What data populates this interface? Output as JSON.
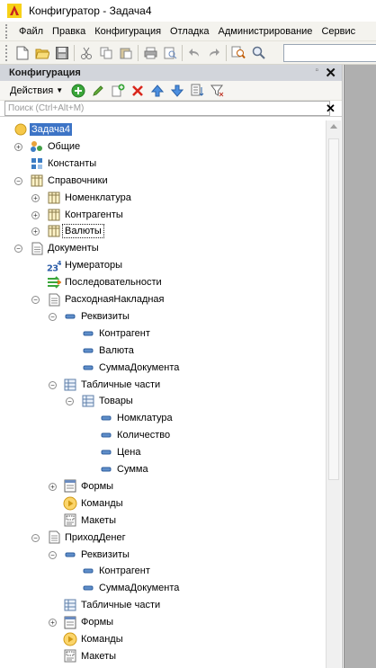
{
  "window": {
    "title": "Конфигуратор - Задача4"
  },
  "menu": [
    "Файл",
    "Правка",
    "Конфигурация",
    "Отладка",
    "Администрирование",
    "Сервис"
  ],
  "toolbar": {
    "buttons": [
      "new-document-icon",
      "open-folder-icon",
      "save-icon",
      "cut-icon",
      "copy-icon",
      "paste-icon",
      "print-icon",
      "print-preview-icon",
      "undo-icon",
      "redo-icon",
      "find-in-config-icon",
      "search-icon"
    ]
  },
  "panel": {
    "title": "Конфигурация",
    "actions_label": "Действия",
    "search_placeholder": "Поиск (Ctrl+Alt+M)"
  },
  "tree": [
    {
      "label": "Задача4",
      "icon": "config-root-icon",
      "level": 0,
      "expander": "minus",
      "selected": true
    },
    {
      "label": "Общие",
      "icon": "common-icon",
      "level": 1,
      "expander": "plus"
    },
    {
      "label": "Константы",
      "icon": "constants-icon",
      "level": 1,
      "expander": "none"
    },
    {
      "label": "Справочники",
      "icon": "catalogs-icon",
      "level": 1,
      "expander": "minus"
    },
    {
      "label": "Номенклатура",
      "icon": "catalog-icon",
      "level": 2,
      "expander": "plus"
    },
    {
      "label": "Контрагенты",
      "icon": "catalog-icon",
      "level": 2,
      "expander": "plus"
    },
    {
      "label": "Валюты",
      "icon": "catalog-icon",
      "level": 2,
      "expander": "plus",
      "focused": true
    },
    {
      "label": "Документы",
      "icon": "documents-icon",
      "level": 1,
      "expander": "minus"
    },
    {
      "label": "Нумераторы",
      "icon": "numerators-icon",
      "level": 2,
      "expander": "none"
    },
    {
      "label": "Последовательности",
      "icon": "sequences-icon",
      "level": 2,
      "expander": "none"
    },
    {
      "label": "РасходнаяНакладная",
      "icon": "document-icon",
      "level": 2,
      "expander": "minus"
    },
    {
      "label": "Реквизиты",
      "icon": "attributes-icon",
      "level": 3,
      "expander": "minus"
    },
    {
      "label": "Контрагент",
      "icon": "attribute-icon",
      "level": 4,
      "expander": "none"
    },
    {
      "label": "Валюта",
      "icon": "attribute-icon",
      "level": 4,
      "expander": "none"
    },
    {
      "label": "СуммаДокумента",
      "icon": "attribute-icon",
      "level": 4,
      "expander": "none"
    },
    {
      "label": "Табличные части",
      "icon": "tabular-sections-icon",
      "level": 3,
      "expander": "minus"
    },
    {
      "label": "Товары",
      "icon": "tabular-section-icon",
      "level": 4,
      "expander": "minus"
    },
    {
      "label": "Номклатура",
      "icon": "attribute-icon",
      "level": 5,
      "expander": "none"
    },
    {
      "label": "Количество",
      "icon": "attribute-icon",
      "level": 5,
      "expander": "none"
    },
    {
      "label": "Цена",
      "icon": "attribute-icon",
      "level": 5,
      "expander": "none"
    },
    {
      "label": "Сумма",
      "icon": "attribute-icon",
      "level": 5,
      "expander": "none"
    },
    {
      "label": "Формы",
      "icon": "forms-icon",
      "level": 3,
      "expander": "plus"
    },
    {
      "label": "Команды",
      "icon": "commands-icon",
      "level": 3,
      "expander": "none"
    },
    {
      "label": "Макеты",
      "icon": "templates-icon",
      "level": 3,
      "expander": "none"
    },
    {
      "label": "ПриходДенег",
      "icon": "document-icon",
      "level": 2,
      "expander": "minus"
    },
    {
      "label": "Реквизиты",
      "icon": "attributes-icon",
      "level": 3,
      "expander": "minus"
    },
    {
      "label": "Контрагент",
      "icon": "attribute-icon",
      "level": 4,
      "expander": "none"
    },
    {
      "label": "СуммаДокумента",
      "icon": "attribute-icon",
      "level": 4,
      "expander": "none"
    },
    {
      "label": "Табличные части",
      "icon": "tabular-sections-icon",
      "level": 3,
      "expander": "none"
    },
    {
      "label": "Формы",
      "icon": "forms-icon",
      "level": 3,
      "expander": "plus"
    },
    {
      "label": "Команды",
      "icon": "commands-icon",
      "level": 3,
      "expander": "none"
    },
    {
      "label": "Макеты",
      "icon": "templates-icon",
      "level": 3,
      "expander": "none"
    }
  ],
  "colors": {
    "selection": "#3d74c6",
    "panel_header": "#d2d5db",
    "menubar": "#f4f3ee",
    "workspace": "#afafaf"
  }
}
